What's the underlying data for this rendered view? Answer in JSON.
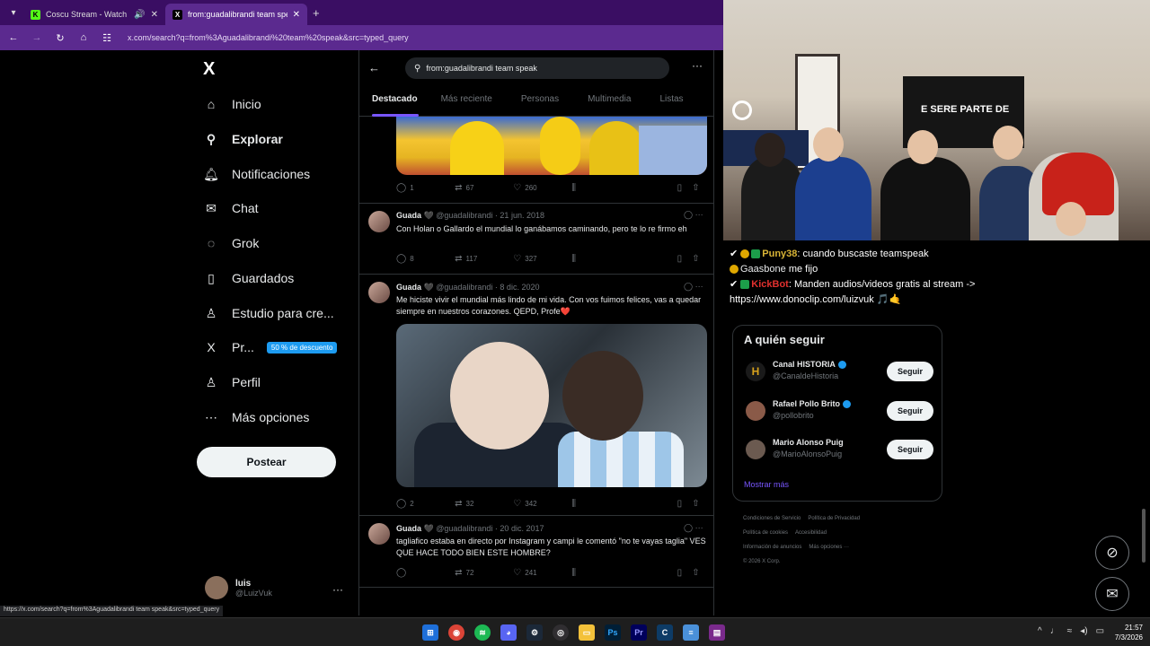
{
  "browser": {
    "tabs": [
      {
        "title": "Coscu Stream - Watch Live",
        "favicon": "K",
        "favicon_color": "#53fc18"
      },
      {
        "title": "from:guadalibrandi team spea",
        "favicon": "X",
        "favicon_color": "#000000"
      }
    ],
    "url": "x.com/search?q=from%3Aguadalibrandi%20team%20speak&src=typed_query",
    "status_url": "https://x.com/search?q=from%3Aguadalibrandi team speak&src=typed_query"
  },
  "sidebar": {
    "logo": "X",
    "items": [
      {
        "label": "Inicio",
        "icon": "home-icon",
        "glyph": "⌂"
      },
      {
        "label": "Explorar",
        "icon": "search-icon",
        "glyph": "⚲",
        "active": true
      },
      {
        "label": "Notificaciones",
        "icon": "bell-icon",
        "glyph": "♫"
      },
      {
        "label": "Chat",
        "icon": "mail-icon",
        "glyph": "✉"
      },
      {
        "label": "Grok",
        "icon": "grok-icon",
        "glyph": "◌"
      },
      {
        "label": "Guardados",
        "icon": "bookmark-icon",
        "glyph": "⚑"
      },
      {
        "label": "Estudio para cre...",
        "icon": "studio-icon",
        "glyph": "♙"
      },
      {
        "label": "Pr...",
        "icon": "x-premium-icon",
        "glyph": "X",
        "badge": "50 % de descuento"
      },
      {
        "label": "Perfil",
        "icon": "person-icon",
        "glyph": "♙"
      },
      {
        "label": "Más opciones",
        "icon": "more-circle-icon",
        "glyph": "⋯"
      }
    ],
    "post_button": "Postear",
    "account": {
      "name": "luis",
      "handle": "@LuizVuk"
    }
  },
  "search": {
    "query": "from:guadalibrandi team speak",
    "tabs": [
      "Destacado",
      "Más reciente",
      "Personas",
      "Multimedia",
      "Listas"
    ],
    "selected_tab": 0
  },
  "tweets": [
    {
      "stats": {
        "replies": "1",
        "reposts": "67",
        "likes": "260"
      }
    },
    {
      "name": "Guada",
      "meta": "@guadalibrandi · 21 jun. 2018",
      "text": "Con Holan o Gallardo el mundial lo ganábamos caminando, pero te lo re firmo eh",
      "stats": {
        "replies": "8",
        "reposts": "117",
        "likes": "327"
      }
    },
    {
      "name": "Guada",
      "meta": "@guadalibrandi · 8 dic. 2020",
      "text": "Me hiciste vivir el mundial más lindo de mi vida. Con vos fuimos felices, vas a quedar siempre en nuestros corazones. QEPD, Profe❤️",
      "stats": {
        "replies": "2",
        "reposts": "32",
        "likes": "342"
      }
    },
    {
      "name": "Guada",
      "meta": "@guadalibrandi · 20 dic. 2017",
      "text": "tagliafico estaba en directo por Instagram y campi le comentó \"no te vayas taglia\" VES QUE HACE TODO BIEN ESTE HOMBRE?",
      "stats": {
        "replies": "",
        "reposts": "72",
        "likes": "241"
      }
    }
  ],
  "stream": {
    "overlay_text": "E SERE PARTE DE",
    "chat": [
      {
        "user": "Puny38",
        "text": ": cuando buscaste teamspeak"
      },
      {
        "user": "Gaasbone",
        "text": " me fijo"
      },
      {
        "user": "KickBot",
        "text": ": Manden audios/videos gratis al stream ->"
      },
      {
        "user": "",
        "text": "https://www.donoclip.com/luizvuk 🎵🤙"
      }
    ]
  },
  "who_to_follow": {
    "title": "A quién seguir",
    "follow_label": "Seguir",
    "show_more": "Mostrar más",
    "accounts": [
      {
        "name": "Canal HISTORIA",
        "handle": "@CanaldeHistoria",
        "avatar_color": "#1a1a1a"
      },
      {
        "name": "Rafael Pollo Brito",
        "handle": "@pollobrito",
        "avatar_color": "#8a5a48"
      },
      {
        "name": "Mario Alonso Puig",
        "handle": "@MarioAlonsoPuig",
        "avatar_color": "#6b5a50"
      }
    ]
  },
  "footer": {
    "links": [
      "Condiciones de Servicio",
      "Política de Privacidad",
      "Política de cookies",
      "Accesibilidad",
      "Información de anuncios",
      "Más opciones ···",
      "© 2026 X Corp."
    ]
  },
  "taskbar": {
    "time": "21:57",
    "date": "7/3/2026",
    "apps": [
      "start",
      "chrome",
      "spotify",
      "discord",
      "steam",
      "obs",
      "explorer",
      "photoshop",
      "premiere",
      "ccleaner",
      "notepad",
      "winrar"
    ]
  }
}
